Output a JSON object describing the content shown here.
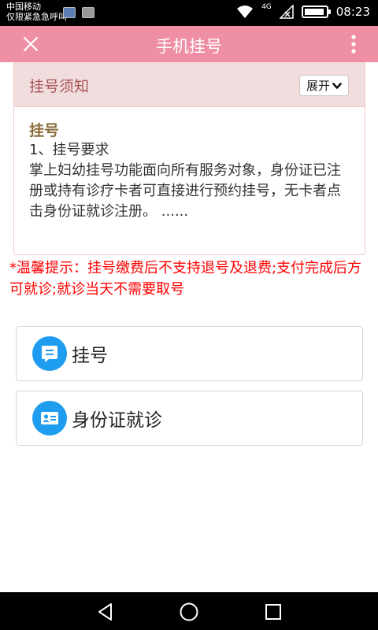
{
  "status_bar": {
    "carrier": "中国移动",
    "emergency": "仅限紧急急呼叫",
    "network": "4G",
    "time": "08:23"
  },
  "header": {
    "title": "手机挂号"
  },
  "notice": {
    "title": "挂号须知",
    "expand_label": "展开",
    "subtitle": "挂号",
    "line1": "1、挂号要求",
    "body": "掌上妇幼挂号功能面向所有服务对象，身份证已注册或持有诊疗卡者可直接进行预约挂号，无卡者点击身份证就诊注册。 ......"
  },
  "warning": "*温馨提示：挂号缴费后不支持退号及退费;支付完成后方可就诊;就诊当天不需要取号",
  "actions": [
    {
      "label": "挂号",
      "icon": "message-icon"
    },
    {
      "label": "身份证就诊",
      "icon": "id-card-icon"
    }
  ],
  "colors": {
    "header_bg": "#ef8fa6",
    "notice_head_bg": "#f1dddd",
    "notice_title": "#a8545a",
    "subtitle": "#8a6d3b",
    "warning": "#ff0000",
    "icon_bg": "#1e9cf0"
  }
}
